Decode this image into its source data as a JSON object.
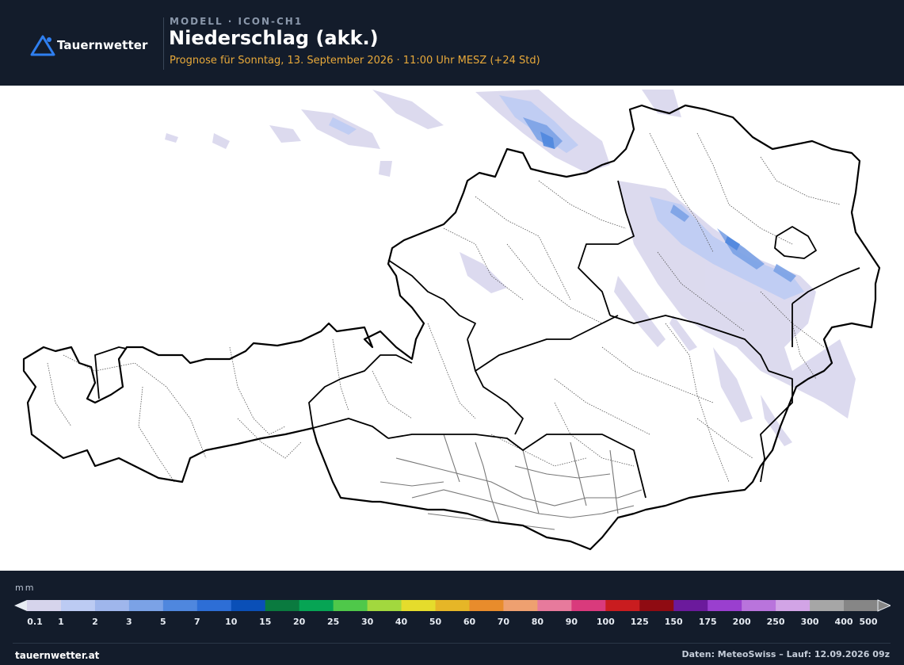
{
  "header": {
    "brand": "Tauernwetter",
    "model_label": "MODELL · ICON-CH1",
    "title": "Niederschlag (akk.)",
    "forecast": "Prognose für Sonntag, 13. September 2026 · 11:00 Uhr MESZ  (+24 Std)"
  },
  "map": {
    "background": "#ffffff",
    "border_color": "#000000",
    "district_color": "#555555",
    "river_color": "#777777"
  },
  "legend": {
    "unit": "mm",
    "ticks": [
      "0.1",
      "1",
      "2",
      "3",
      "5",
      "7",
      "10",
      "15",
      "20",
      "25",
      "30",
      "40",
      "50",
      "60",
      "70",
      "80",
      "90",
      "100",
      "125",
      "150",
      "175",
      "200",
      "250",
      "300",
      "400",
      "500"
    ],
    "colors": [
      "#d6d4ec",
      "#bccbf3",
      "#9fb6ec",
      "#7ba2e6",
      "#4f87de",
      "#2d6ed6",
      "#0a4fb7",
      "#0a7a3f",
      "#06a454",
      "#4fc84a",
      "#a2d83e",
      "#e5dc2c",
      "#e6b627",
      "#e88c2c",
      "#eea070",
      "#e77a9c",
      "#d93a7c",
      "#c91c1f",
      "#8f0b12",
      "#6b1a9c",
      "#9a3fcf",
      "#b974dc",
      "#d2a4e6",
      "#a6a6a6",
      "#868686"
    ],
    "arrow_color": "#e8edf4"
  },
  "footer": {
    "site": "tauernwetter.at",
    "credits": "Daten: MeteoSwiss – Lauf: 12.09.2026 09z"
  }
}
